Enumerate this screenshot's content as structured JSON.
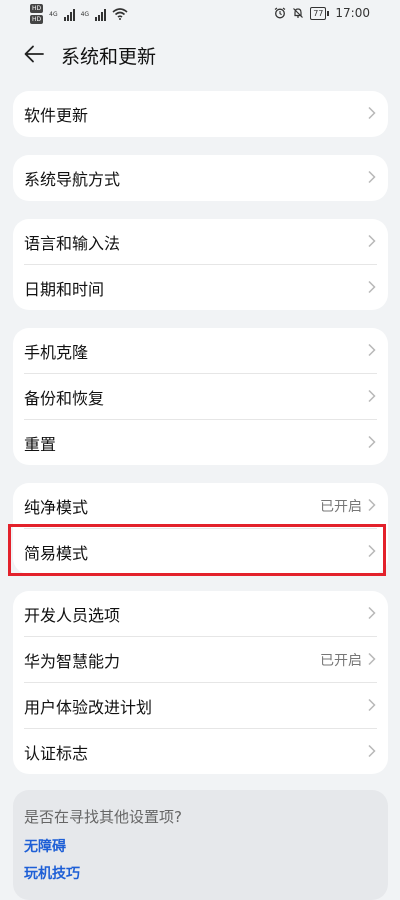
{
  "status_bar": {
    "sim1": "HD",
    "sim2": "HD",
    "net1": "4G",
    "net2": "4G",
    "battery": "77",
    "time": "17:00"
  },
  "header": {
    "title": "系统和更新"
  },
  "groups": [
    {
      "items": [
        {
          "label": "软件更新"
        }
      ]
    },
    {
      "items": [
        {
          "label": "系统导航方式"
        }
      ]
    },
    {
      "items": [
        {
          "label": "语言和输入法"
        },
        {
          "label": "日期和时间"
        }
      ]
    },
    {
      "items": [
        {
          "label": "手机克隆"
        },
        {
          "label": "备份和恢复"
        },
        {
          "label": "重置"
        }
      ]
    },
    {
      "items": [
        {
          "label": "纯净模式",
          "value": "已开启"
        },
        {
          "label": "简易模式"
        }
      ]
    },
    {
      "items": [
        {
          "label": "开发人员选项"
        },
        {
          "label": "华为智慧能力",
          "value": "已开启"
        },
        {
          "label": "用户体验改进计划"
        },
        {
          "label": "认证标志"
        }
      ]
    }
  ],
  "suggestions": {
    "title": "是否在寻找其他设置项?",
    "links": [
      "无障碍",
      "玩机技巧"
    ]
  },
  "colors": {
    "background": "#f1f3f5",
    "highlight": "#e3212b",
    "link": "#1e5fd6"
  }
}
